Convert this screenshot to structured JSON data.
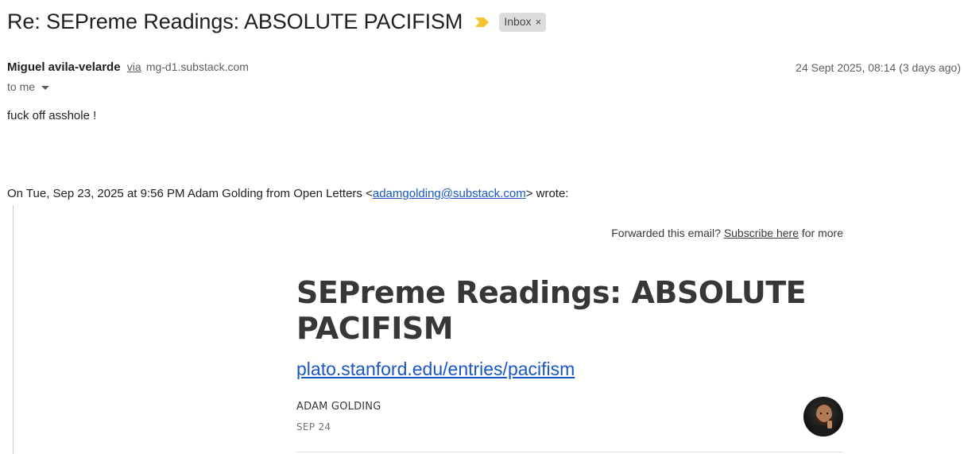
{
  "email": {
    "subject": "Re: SEPreme Readings: ABSOLUTE PACIFISM",
    "importance_icon": "importance-marker-icon",
    "label": "Inbox",
    "label_close": "×",
    "sender_name": "Miguel avila-velarde",
    "via_label": "via",
    "via_domain": "mg-d1.substack.com",
    "date": "24 Sept 2025, 08:14 (3 days ago)",
    "recipient": "to me",
    "body": "fuck off asshole !"
  },
  "quote": {
    "header_prefix": "On Tue, Sep 23, 2025 at 9:56 PM Adam Golding from Open Letters <",
    "header_email": "adamgolding@substack.com",
    "header_suffix": "> wrote:",
    "forwarded_prefix": "Forwarded this email? ",
    "forwarded_link": "Subscribe here",
    "forwarded_suffix": " for more",
    "post_title": "SEPreme Readings: ABSOLUTE PACIFISM",
    "post_link": "plato.stanford.edu/entries/pacifism",
    "author": "ADAM GOLDING",
    "post_date": "SEP 24"
  },
  "colors": {
    "importance": "#f4c430",
    "link": "#1a56c4",
    "chip_bg": "#dddddd"
  }
}
